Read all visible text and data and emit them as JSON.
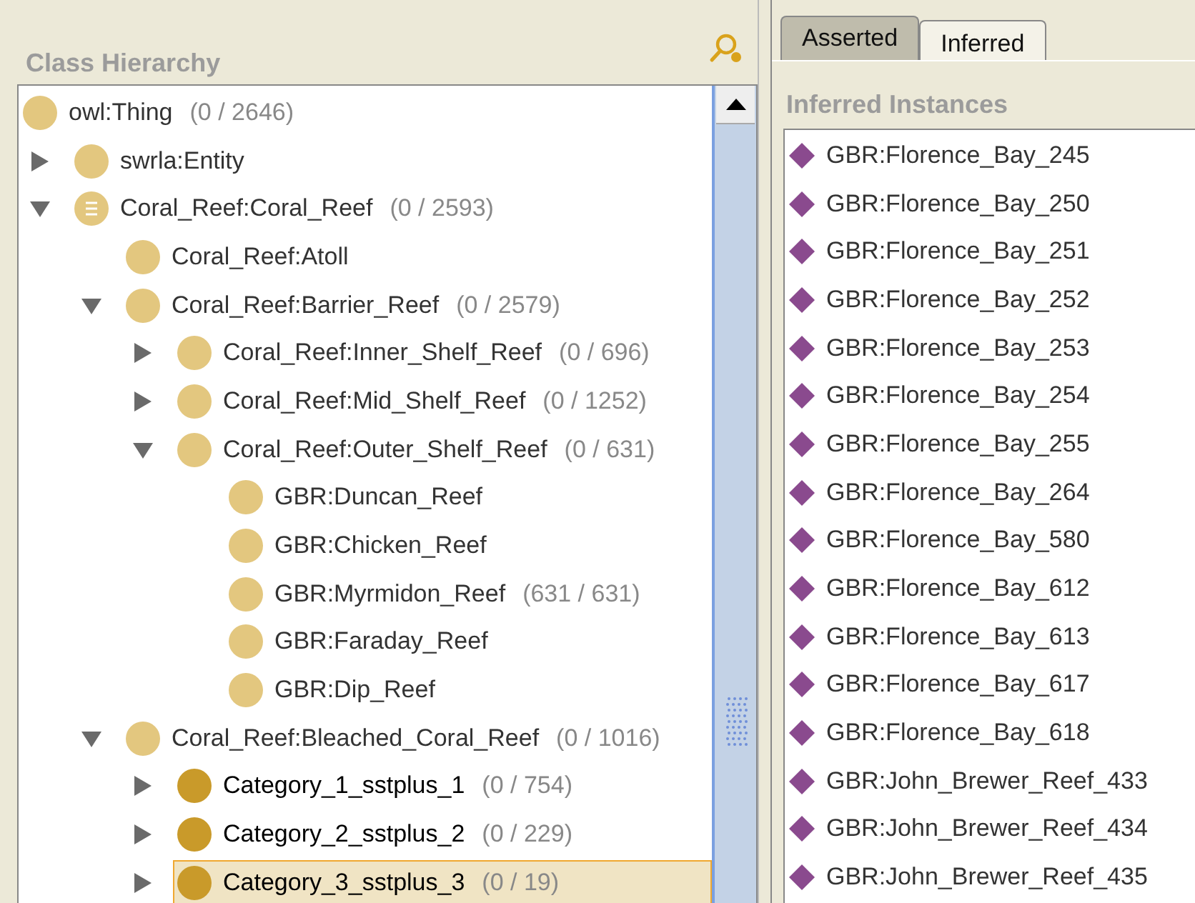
{
  "class_hierarchy": {
    "title": "Class Hierarchy",
    "tree": [
      {
        "label": "owl:Thing",
        "count": "(0 / 2646)",
        "kind": "class",
        "color": "#e3c77f",
        "selected": false,
        "children": [
          {
            "label": "swrla:Entity",
            "kind": "class",
            "color": "#e3c77f",
            "expanded": false,
            "selected": false
          },
          {
            "label": "Coral_Reef:Coral_Reef",
            "count": "(0 / 2593)",
            "kind": "defined",
            "color": "#e3c77f",
            "expanded": true,
            "selected": false,
            "children": [
              {
                "label": "Coral_Reef:Atoll",
                "kind": "class",
                "color": "#e3c77f",
                "selected": false
              },
              {
                "label": "Coral_Reef:Barrier_Reef",
                "count": "(0 / 2579)",
                "kind": "class",
                "color": "#e3c77f",
                "expanded": true,
                "selected": false,
                "children": [
                  {
                    "label": "Coral_Reef:Inner_Shelf_Reef",
                    "count": "(0 / 696)",
                    "kind": "class",
                    "color": "#e3c77f",
                    "expanded": false,
                    "selected": false
                  },
                  {
                    "label": "Coral_Reef:Mid_Shelf_Reef",
                    "count": "(0 / 1252)",
                    "kind": "class",
                    "color": "#e3c77f",
                    "expanded": false,
                    "selected": false
                  },
                  {
                    "label": "Coral_Reef:Outer_Shelf_Reef",
                    "count": "(0 / 631)",
                    "kind": "class",
                    "color": "#e3c77f",
                    "expanded": true,
                    "selected": false,
                    "children": [
                      {
                        "label": "GBR:Duncan_Reef",
                        "kind": "class",
                        "color": "#e3c77f",
                        "selected": false
                      },
                      {
                        "label": "GBR:Chicken_Reef",
                        "kind": "class",
                        "color": "#e3c77f",
                        "selected": false
                      },
                      {
                        "label": "GBR:Myrmidon_Reef",
                        "count": "(631 / 631)",
                        "kind": "class",
                        "color": "#e3c77f",
                        "selected": false
                      },
                      {
                        "label": "GBR:Faraday_Reef",
                        "kind": "class",
                        "color": "#e3c77f",
                        "selected": false
                      },
                      {
                        "label": "GBR:Dip_Reef",
                        "kind": "class",
                        "color": "#e3c77f",
                        "selected": false
                      }
                    ]
                  }
                ]
              },
              {
                "label": "Coral_Reef:Bleached_Coral_Reef",
                "count": "(0 / 1016)",
                "kind": "class",
                "color": "#e3c77f",
                "expanded": true,
                "selected": false,
                "children": [
                  {
                    "label": "Category_1_sstplus_1",
                    "count": "(0 / 754)",
                    "kind": "class",
                    "color": "#c99a2a",
                    "expanded": false,
                    "selected": false
                  },
                  {
                    "label": "Category_2_sstplus_2",
                    "count": "(0 / 229)",
                    "kind": "class",
                    "color": "#c99a2a",
                    "expanded": false,
                    "selected": false
                  },
                  {
                    "label": "Category_3_sstplus_3",
                    "count": "(0 / 19)",
                    "kind": "class",
                    "color": "#c99a2a",
                    "expanded": false,
                    "selected": true
                  }
                ]
              }
            ]
          }
        ]
      }
    ]
  },
  "tabs": [
    {
      "label": "Asserted",
      "selected": false
    },
    {
      "label": "Inferred",
      "selected": true
    }
  ],
  "instances": {
    "title": "Inferred Instances",
    "items": [
      "GBR:Florence_Bay_245",
      "GBR:Florence_Bay_250",
      "GBR:Florence_Bay_251",
      "GBR:Florence_Bay_252",
      "GBR:Florence_Bay_253",
      "GBR:Florence_Bay_254",
      "GBR:Florence_Bay_255",
      "GBR:Florence_Bay_264",
      "GBR:Florence_Bay_580",
      "GBR:Florence_Bay_612",
      "GBR:Florence_Bay_613",
      "GBR:Florence_Bay_617",
      "GBR:Florence_Bay_618",
      "GBR:John_Brewer_Reef_433",
      "GBR:John_Brewer_Reef_434",
      "GBR:John_Brewer_Reef_435"
    ]
  }
}
